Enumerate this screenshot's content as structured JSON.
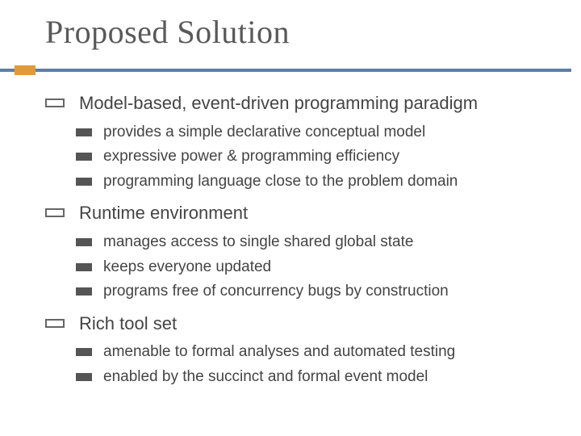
{
  "title": "Proposed Solution",
  "items": [
    {
      "label": "Model-based, event-driven programming paradigm",
      "sub": [
        "provides a simple declarative conceptual model",
        "expressive power & programming efficiency",
        "programming language close to the problem domain"
      ]
    },
    {
      "label": "Runtime environment",
      "sub": [
        "manages access to single shared global state",
        "keeps everyone updated",
        "programs free of concurrency bugs by construction"
      ]
    },
    {
      "label": "Rich tool set",
      "sub": [
        "amenable to formal analyses and automated testing",
        "enabled by the succinct and formal event model"
      ]
    }
  ]
}
